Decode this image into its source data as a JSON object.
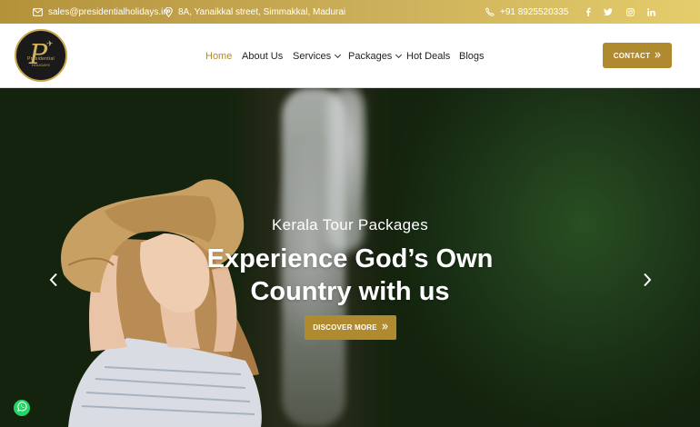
{
  "topbar": {
    "email": "sales@presidentialholidays.in",
    "address": "8A, Yanaikkal street, Simmakkal, Madurai",
    "phone": "+91 8925520335",
    "social": [
      {
        "icon": "facebook-icon",
        "glyph": "f"
      },
      {
        "icon": "twitter-icon",
        "glyph": "t"
      },
      {
        "icon": "instagram-icon",
        "glyph": "ig"
      },
      {
        "icon": "linkedin-icon",
        "glyph": "in"
      }
    ]
  },
  "logo": {
    "letter": "P",
    "line1": "Presidential",
    "line2": "HOLIDAYS"
  },
  "nav": {
    "items": [
      {
        "label": "Home",
        "active": true,
        "dropdown": false
      },
      {
        "label": "About Us",
        "active": false,
        "dropdown": false
      },
      {
        "label": "Services",
        "active": false,
        "dropdown": true
      },
      {
        "label": "Packages",
        "active": false,
        "dropdown": true
      },
      {
        "label": "Hot Deals",
        "active": false,
        "dropdown": false
      },
      {
        "label": "Blogs",
        "active": false,
        "dropdown": false
      }
    ],
    "contact_label": "CONTACT"
  },
  "hero": {
    "subtitle": "Kerala Tour Packages",
    "headline_line1": "Experience God’s Own",
    "headline_line2": "Country with us",
    "cta_label": "DISCOVER MORE",
    "prev_icon": "chevron-left-icon",
    "next_icon": "chevron-right-icon"
  },
  "colors": {
    "gold": "#b08a2e",
    "topbar_gradient": [
      "#b3923a",
      "#e4cd6b"
    ],
    "whatsapp": "#25d366"
  }
}
